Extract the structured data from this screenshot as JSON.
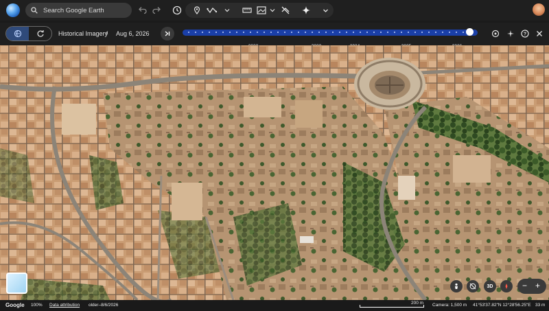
{
  "toolbar": {
    "search_placeholder": "Search Google Earth",
    "icons": [
      "undo-icon",
      "redo-icon",
      "history-icon",
      "pin-icon",
      "path-icon",
      "ruler-icon",
      "image-icon",
      "expand-icon",
      "layers-off-icon",
      "sparkle-icon",
      "chevron-down-icon"
    ]
  },
  "history": {
    "label": "Historical Imagery",
    "date": "Aug 6, 2026",
    "years": [
      "2022",
      "2023",
      "2024",
      "2025",
      "2026"
    ],
    "position": 1.0
  },
  "status": {
    "logo": "Google",
    "zoom": "100%",
    "attribution": "Data attribution",
    "range": "older–8/6/2026",
    "scale": "200 m",
    "camera": "Camera: 1,500 m",
    "coords": "41°53'37.82\"N 12°28'56.25\"E",
    "elevation": "33 m"
  },
  "controls": {
    "view_3d": "3D"
  },
  "colors": {
    "accent": "#1a3fa8",
    "bar_bg": "#1f1f1f"
  }
}
